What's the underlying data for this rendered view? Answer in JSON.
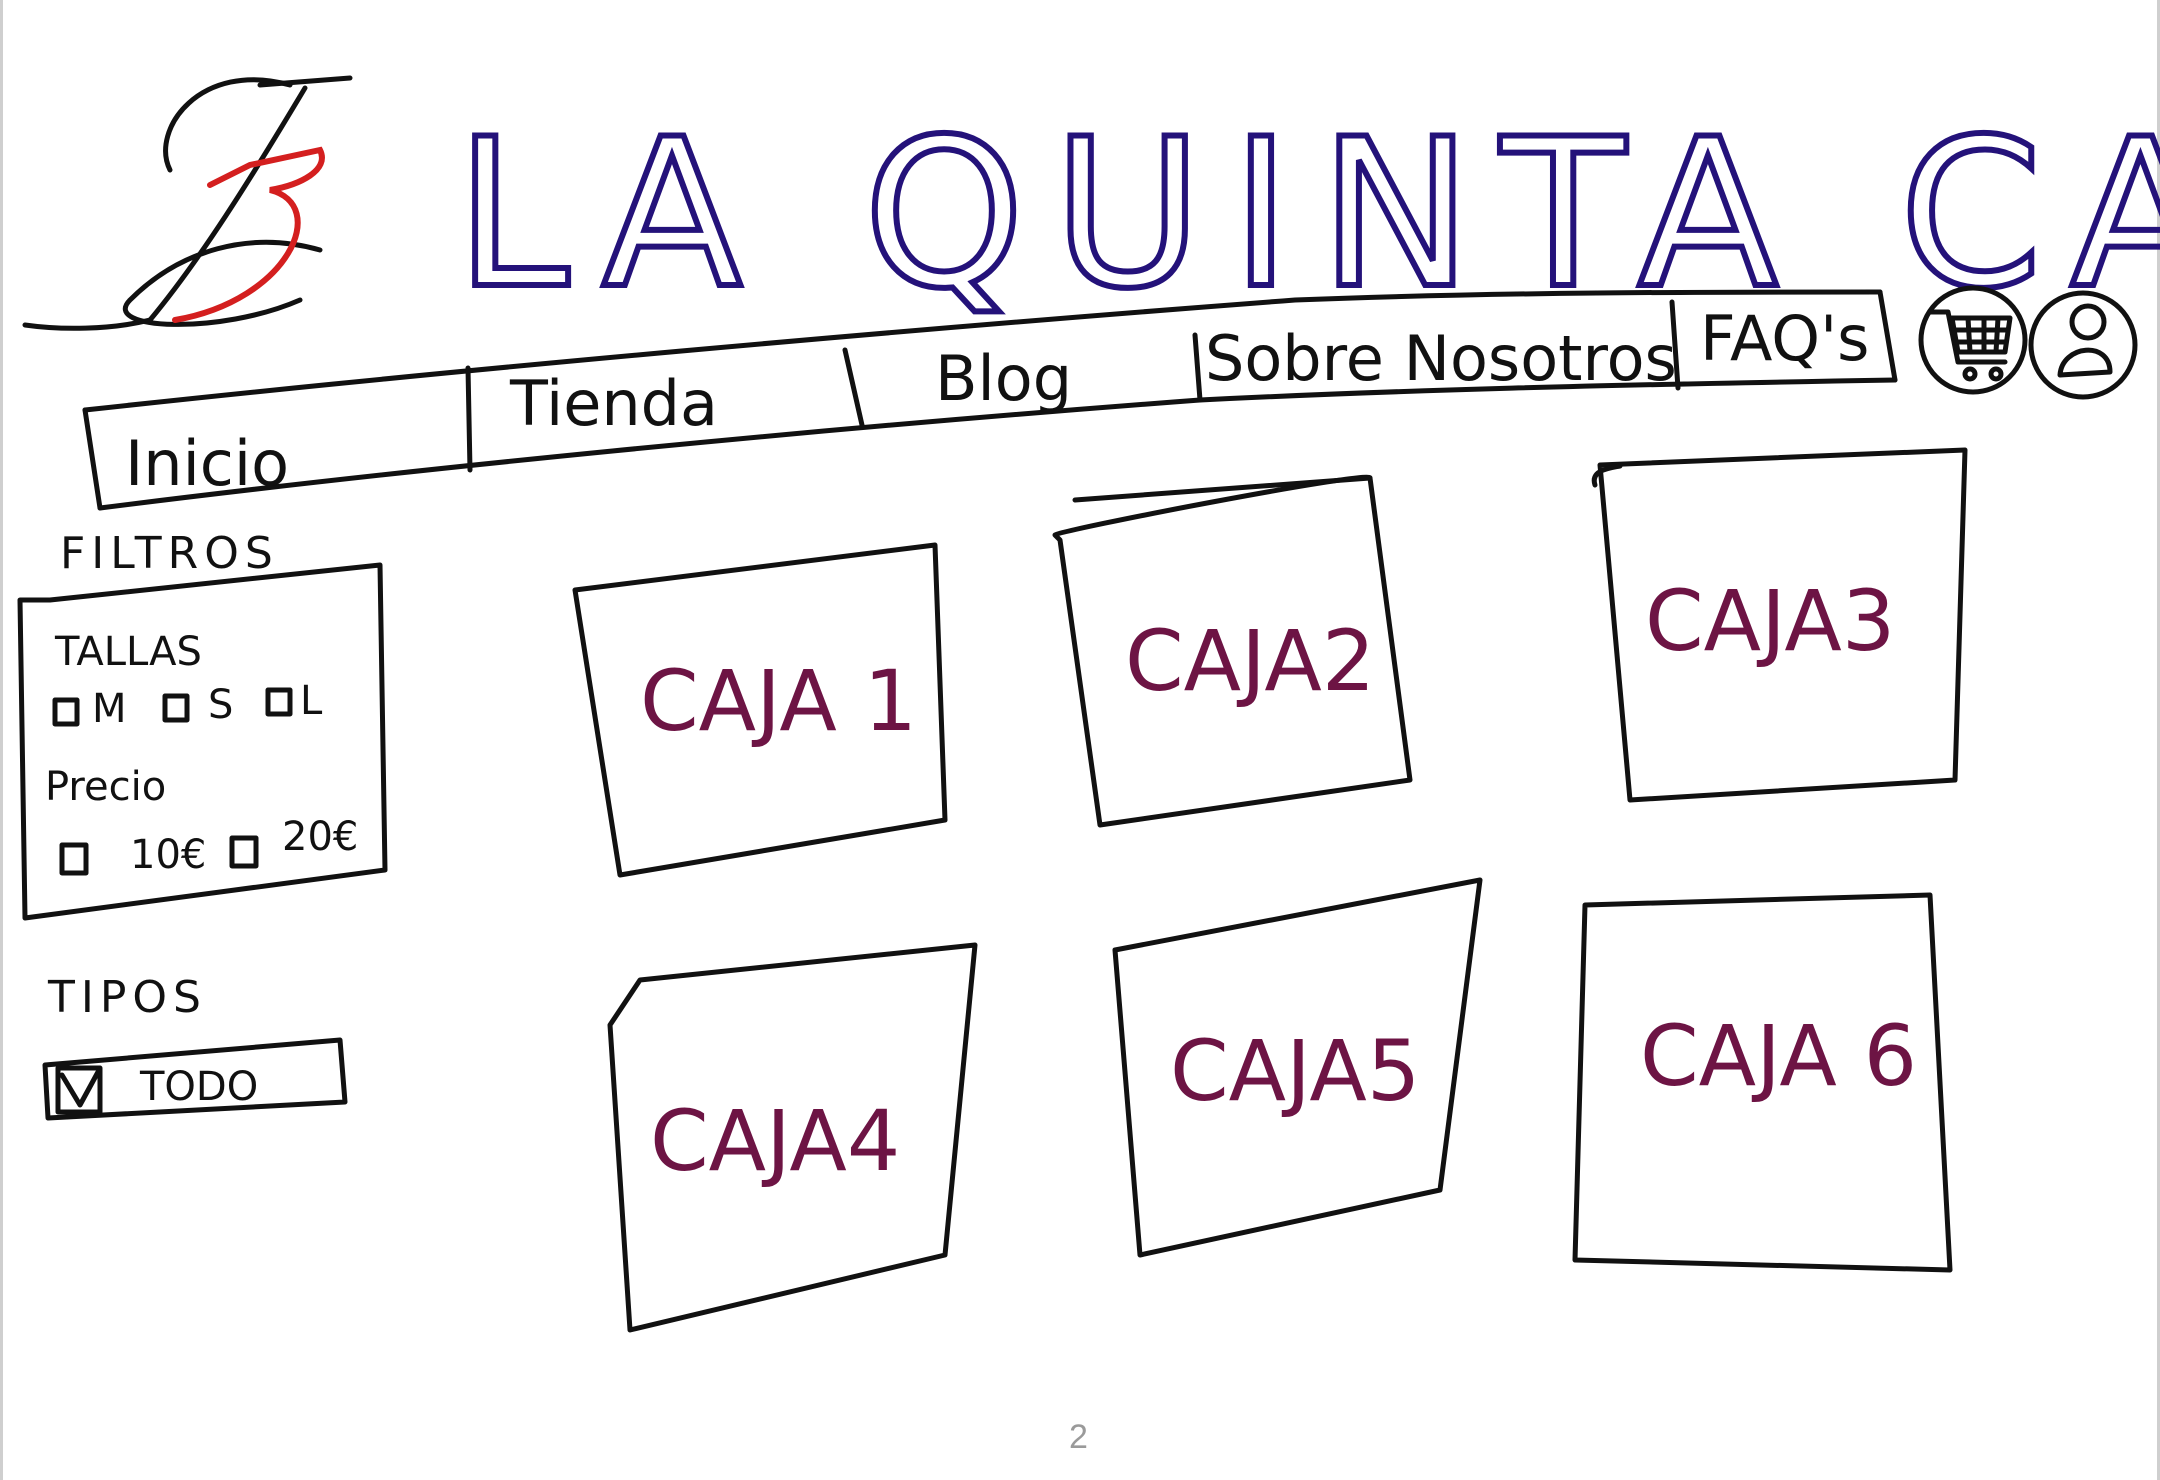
{
  "header": {
    "title": "LA QUINTA CAJA",
    "logo_icon": "lqc-monogram-icon"
  },
  "nav": {
    "items": [
      {
        "label": "Inicio"
      },
      {
        "label": "Tienda"
      },
      {
        "label": "Blog"
      },
      {
        "label": "Sobre Nosotros"
      },
      {
        "label": "FAQ's"
      }
    ],
    "cart_icon": "cart-icon",
    "user_icon": "user-icon"
  },
  "filters": {
    "title": "FILTROS",
    "tallas": {
      "label": "TALLAS",
      "options": [
        "M",
        "S",
        "L"
      ]
    },
    "precio": {
      "label": "Precio",
      "options": [
        "10€",
        "20€"
      ]
    }
  },
  "tipos": {
    "title": "TIPOS",
    "option_label": "TODO",
    "checked": true
  },
  "products": [
    {
      "label": "CAJA 1"
    },
    {
      "label": "CAJA2"
    },
    {
      "label": "CAJA3"
    },
    {
      "label": "CAJA4"
    },
    {
      "label": "CAJA5"
    },
    {
      "label": "CAJA 6"
    }
  ],
  "page_number": "2",
  "colors": {
    "title_ink": "#24127a",
    "card_ink": "#6d1444",
    "logo_accent": "#d41f1f",
    "line_ink": "#111111"
  }
}
